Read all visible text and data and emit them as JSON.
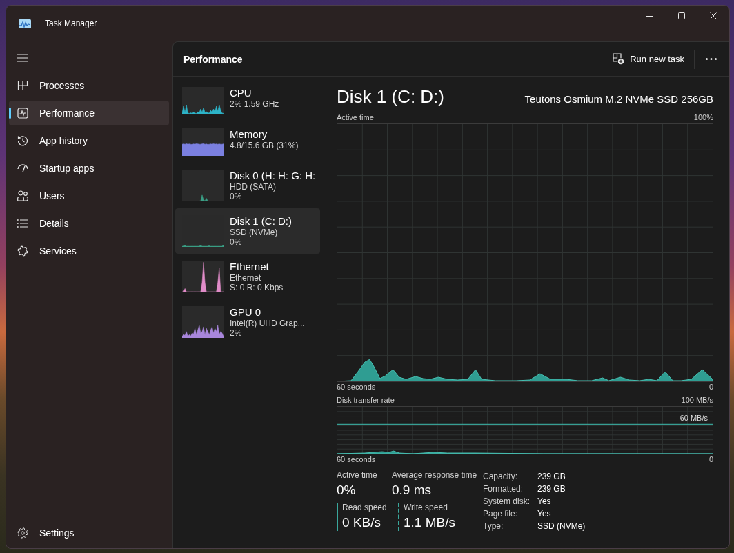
{
  "window": {
    "title": "Task Manager"
  },
  "sidebar": {
    "items": [
      {
        "label": "Processes",
        "selected": false
      },
      {
        "label": "Performance",
        "selected": true
      },
      {
        "label": "App history",
        "selected": false
      },
      {
        "label": "Startup apps",
        "selected": false
      },
      {
        "label": "Users",
        "selected": false
      },
      {
        "label": "Details",
        "selected": false
      },
      {
        "label": "Services",
        "selected": false
      }
    ],
    "footer": {
      "label": "Settings"
    }
  },
  "header": {
    "title": "Performance",
    "action": "Run new task"
  },
  "resources": [
    {
      "name": "CPU",
      "details": [
        "2% 1.59 GHz"
      ],
      "color": "#2db4c8",
      "selected": false
    },
    {
      "name": "Memory",
      "details": [
        "4.8/15.6 GB (31%)"
      ],
      "color": "#7b80e0",
      "selected": false
    },
    {
      "name": "Disk 0 (H: H: G: H:",
      "details": [
        "HDD (SATA)",
        "0%"
      ],
      "color": "#3a9e85",
      "selected": false
    },
    {
      "name": "Disk 1 (C: D:)",
      "details": [
        "SSD (NVMe)",
        "0%"
      ],
      "color": "#3a9e85",
      "selected": true
    },
    {
      "name": "Ethernet",
      "details": [
        "Ethernet",
        "S: 0 R: 0 Kbps"
      ],
      "color": "#e08cc8",
      "selected": false
    },
    {
      "name": "GPU 0",
      "details": [
        "Intel(R) UHD Grap...",
        "2%"
      ],
      "color": "#a886dc",
      "selected": false
    }
  ],
  "detail": {
    "title": "Disk 1 (C: D:)",
    "model": "Teutons Osmium M.2 NVMe SSD 256GB",
    "active_time_graph": {
      "label": "Active time",
      "max": "100%",
      "span": "60 seconds",
      "min": "0"
    },
    "transfer_graph": {
      "label": "Disk transfer rate",
      "max": "100 MB/s",
      "reference": "60 MB/s",
      "span": "60 seconds",
      "min": "0"
    },
    "stats": [
      {
        "label": "Active time",
        "value": "0%"
      },
      {
        "label": "Average response time",
        "value": "0.9 ms"
      }
    ],
    "speeds": [
      {
        "label": "Read speed",
        "value": "0 KB/s",
        "kind": "read"
      },
      {
        "label": "Write speed",
        "value": "1.1 MB/s",
        "kind": "write"
      }
    ],
    "properties": [
      {
        "label": "Capacity:",
        "value": "239 GB"
      },
      {
        "label": "Formatted:",
        "value": "239 GB"
      },
      {
        "label": "System disk:",
        "value": "Yes"
      },
      {
        "label": "Page file:",
        "value": "Yes"
      },
      {
        "label": "Type:",
        "value": "SSD (NVMe)"
      }
    ]
  }
}
